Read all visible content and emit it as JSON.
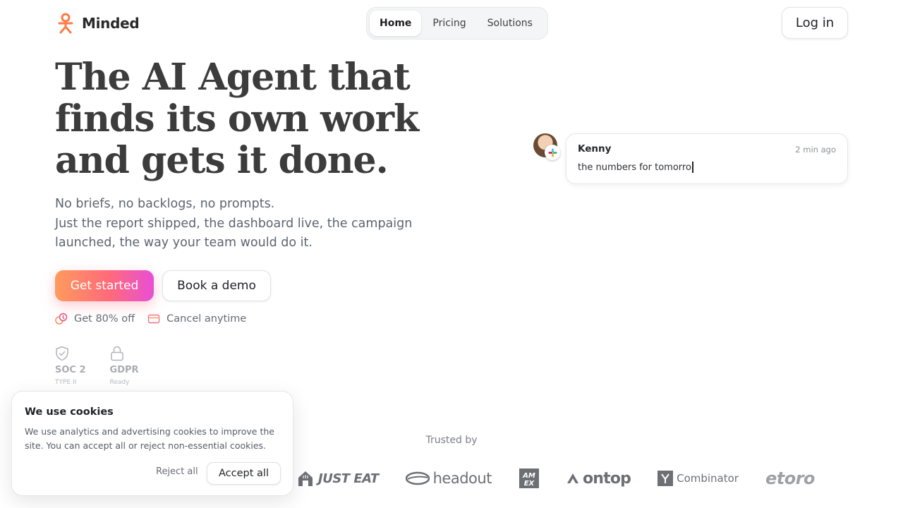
{
  "brand": {
    "name": "Minded",
    "accent": "#ff7a45"
  },
  "nav": {
    "items": [
      {
        "label": "Home",
        "active": true
      },
      {
        "label": "Pricing",
        "active": false
      },
      {
        "label": "Solutions",
        "active": false
      }
    ],
    "login_label": "Log in"
  },
  "hero": {
    "title_lines": [
      "The AI Agent that",
      "finds its own work",
      "and gets it done."
    ],
    "subtitle_lines": [
      "No briefs, no backlogs, no prompts.",
      "Just the report shipped, the dashboard live, the campaign",
      "launched, the way your team would do it."
    ],
    "primary_cta": "Get started",
    "secondary_cta": "Book a demo",
    "perks": [
      {
        "icon": "discount-icon",
        "label": "Get 80% off"
      },
      {
        "icon": "credit-card-icon",
        "label": "Cancel anytime"
      }
    ],
    "badges": [
      {
        "icon": "shield-check-icon",
        "title": "SOC 2",
        "sub": "TYPE II"
      },
      {
        "icon": "lock-icon",
        "title": "GDPR",
        "sub": "Ready"
      }
    ]
  },
  "chat": {
    "name": "Kenny",
    "time": "2 min ago",
    "message": "the numbers for tomorro",
    "source_icon": "slack-icon"
  },
  "trusted": {
    "label": "Trusted by",
    "logos": [
      "JUST EAT",
      "headout",
      "AM EX",
      "ontop",
      "Combinator",
      "etoro"
    ]
  },
  "cookie": {
    "title": "We use cookies",
    "text_lines": [
      "We use analytics and advertising cookies to improve the",
      "site. You can accept all or reject non-essential cookies."
    ],
    "reject_label": "Reject all",
    "accept_label": "Accept all"
  }
}
